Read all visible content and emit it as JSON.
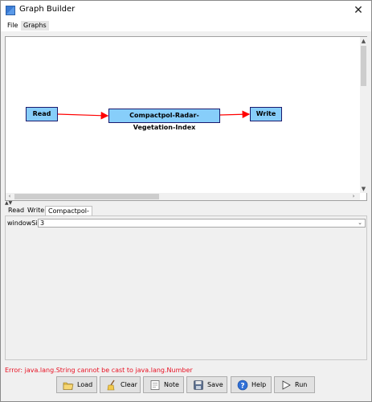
{
  "window": {
    "title": "Graph Builder",
    "close_glyph": "✕"
  },
  "menu": {
    "items": [
      {
        "label": "File"
      },
      {
        "label": "Graphs"
      }
    ]
  },
  "graph": {
    "nodes": [
      {
        "label": "Read"
      },
      {
        "label": "Compactpol-Radar-Vegetation-Index"
      },
      {
        "label": "Write"
      }
    ],
    "edges": [
      {
        "from": "Read",
        "to": "Compactpol-Radar-Vegetation-Index"
      },
      {
        "from": "Compactpol-Radar-Vegetation-Index",
        "to": "Write"
      }
    ],
    "node_fill": "#87cefa",
    "edge_color": "#ff0000"
  },
  "tabs": [
    {
      "label": "Read"
    },
    {
      "label": "Write"
    },
    {
      "label": "Compactpol-Radar-Vegetation-Index"
    }
  ],
  "selected_tab": "Compactpol-Radar-Vegetation-Index",
  "params": {
    "window_size_label": "windowSize",
    "window_size_value": "3"
  },
  "status": {
    "error": "Error: java.lang.String cannot be cast to java.lang.Number",
    "error_color": "#e81123"
  },
  "buttons": [
    {
      "label": "Load",
      "icon": "folder-load-icon"
    },
    {
      "label": "Clear",
      "icon": "broom-icon"
    },
    {
      "label": "Note",
      "icon": "note-icon"
    },
    {
      "label": "Save",
      "icon": "save-disk-icon"
    },
    {
      "label": "Help",
      "icon": "help-icon"
    },
    {
      "label": "Run",
      "icon": "play-icon"
    }
  ]
}
